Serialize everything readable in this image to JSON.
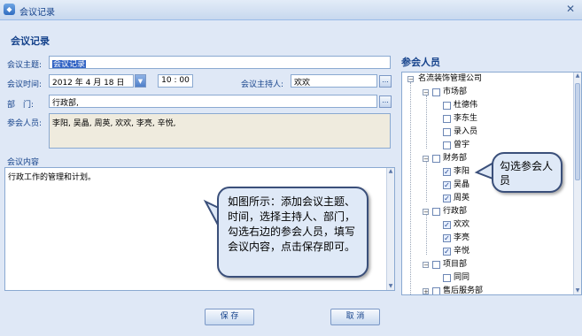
{
  "window": {
    "title": "会议记录",
    "close_glyph": "✕",
    "app_icon_glyph": "◆"
  },
  "form": {
    "heading": "会议记录",
    "topic_label": "会议主题:",
    "topic_value": "会议记录",
    "time_label": "会议时间:",
    "date_value": "2012 年 4 月 18 日",
    "time_value": "10 : 00",
    "host_label": "会议主持人:",
    "host_value": "欢欢",
    "dept_label": "部　门:",
    "dept_value": "行政部,",
    "participants_label": "参会人员:",
    "participants_value": "李阳, 吴晶, 周英, 欢欢, 李亮, 辛悦,",
    "content_label": "会议内容",
    "content_value": "行政工作的管理和计划。",
    "ellipsis": "...",
    "dropdown_glyph": "▼"
  },
  "tree": {
    "heading": "参会人员",
    "root": "名流装饰管理公司",
    "groups": [
      {
        "name": "市场部",
        "members": [
          {
            "name": "杜德伟",
            "checked": false
          },
          {
            "name": "李东生",
            "checked": false
          },
          {
            "name": "录入员",
            "checked": false
          },
          {
            "name": "曾宇",
            "checked": false
          }
        ]
      },
      {
        "name": "财务部",
        "members": [
          {
            "name": "李阳",
            "checked": true
          },
          {
            "name": "吴晶",
            "checked": true
          },
          {
            "name": "周英",
            "checked": true
          }
        ]
      },
      {
        "name": "行政部",
        "members": [
          {
            "name": "欢欢",
            "checked": true
          },
          {
            "name": "李亮",
            "checked": true
          },
          {
            "name": "辛悦",
            "checked": true
          }
        ]
      },
      {
        "name": "项目部",
        "members": [
          {
            "name": "同同",
            "checked": false
          }
        ]
      },
      {
        "name": "售后服务部",
        "members": []
      }
    ]
  },
  "callouts": {
    "left": "如图所示：添加会议主题、时间，选择主持人、部门，勾选右边的参会人员，填写会议内容，点击保存即可。",
    "right": "勾选参会人员"
  },
  "buttons": {
    "save": "保 存",
    "cancel": "取 消"
  },
  "colors": {
    "panel_bg": "#dfe8f6",
    "label_text": "#15428b",
    "selection": "#3163c4",
    "callout_bg": "#dfe9f7"
  }
}
